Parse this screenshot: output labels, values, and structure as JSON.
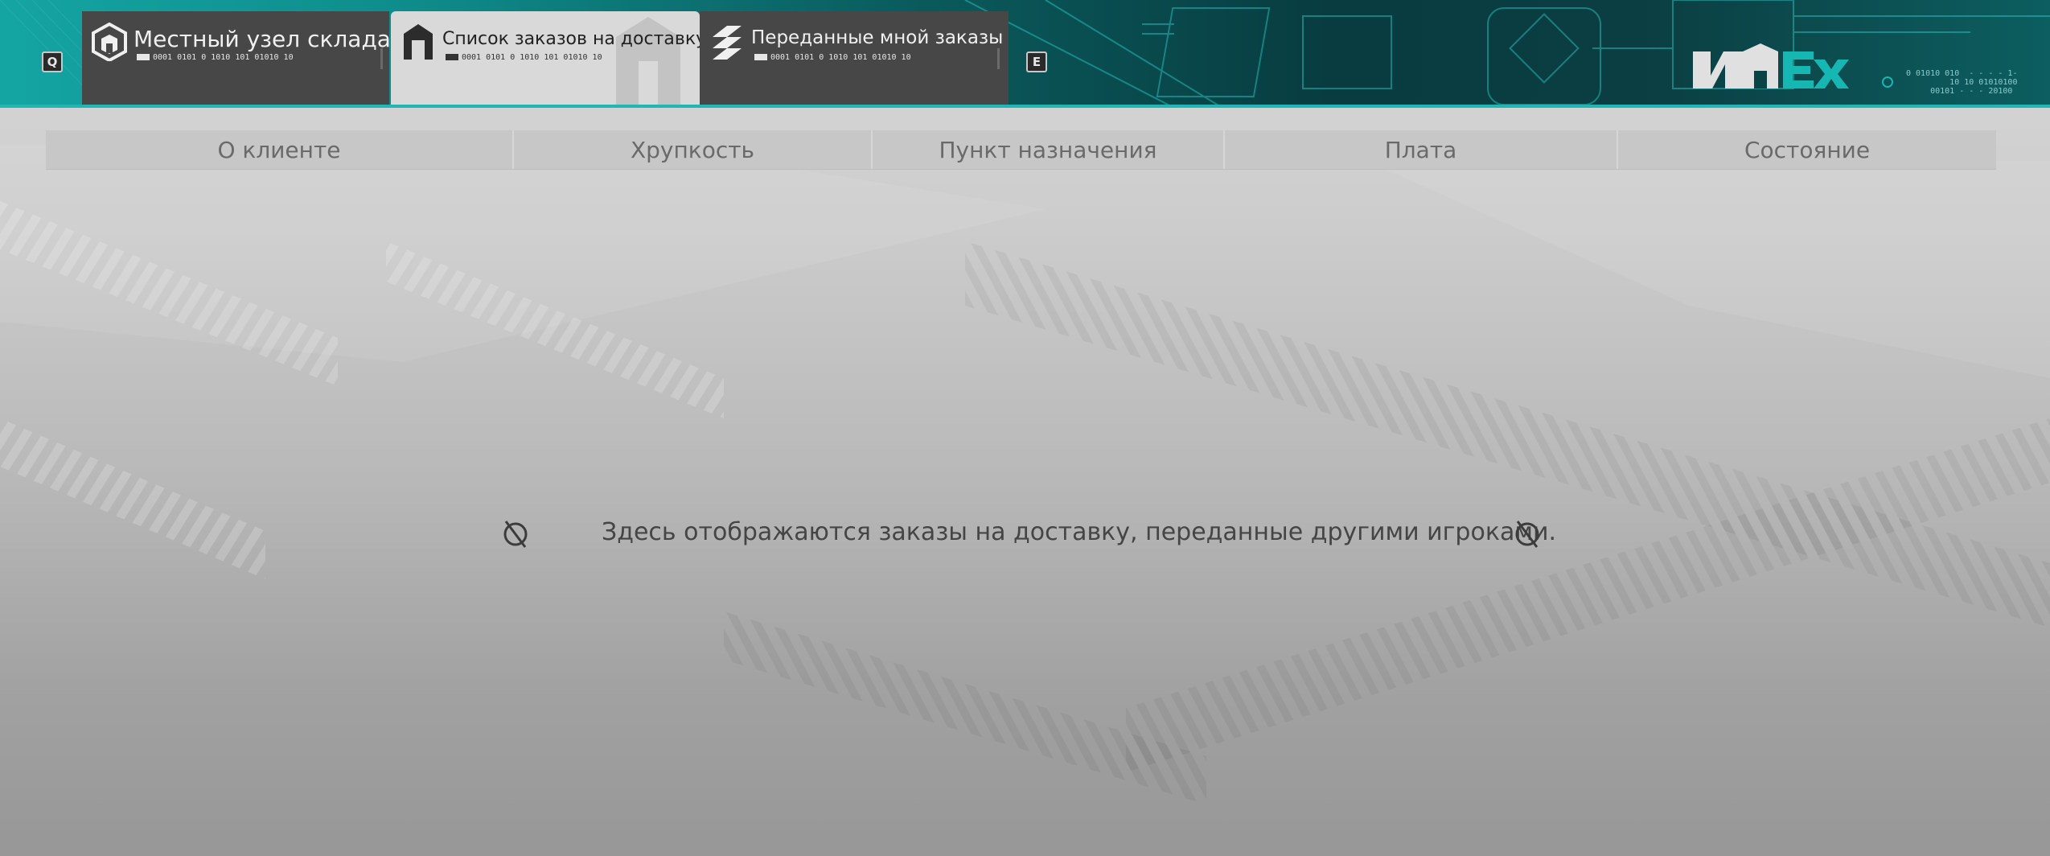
{
  "header": {
    "left_key": "Q",
    "right_key": "E",
    "tabs": [
      {
        "label": "Местный узел склада",
        "code": "0001  0101 0 1010 101 01010 10",
        "active": false,
        "icon": "warehouse-icon"
      },
      {
        "label": "Список заказов на доставку",
        "code": "0001  0101 0 1010 101 01010 10",
        "active": true,
        "icon": "delivery-list-icon"
      },
      {
        "label": "Переданные мной заказы",
        "code": "0001  0101 0 1010 101 01010 10",
        "active": false,
        "icon": "transferred-orders-icon"
      }
    ],
    "logo_bits": "0 01010 010  - - - - 1-\n         10 10 01010100\n     00101 - - - 20100"
  },
  "table": {
    "columns": [
      "О клиенте",
      "Хрупкость",
      "Пункт назначения",
      "Плата",
      "Состояние"
    ]
  },
  "empty_state": {
    "message": "Здесь отображаются заказы на доставку, переданные другими игроками.",
    "icon": "no-entry-icon"
  },
  "colors": {
    "accent_teal": "#14a5a3",
    "tab_inactive": "#474747",
    "tab_active": "#d9d9d9"
  }
}
